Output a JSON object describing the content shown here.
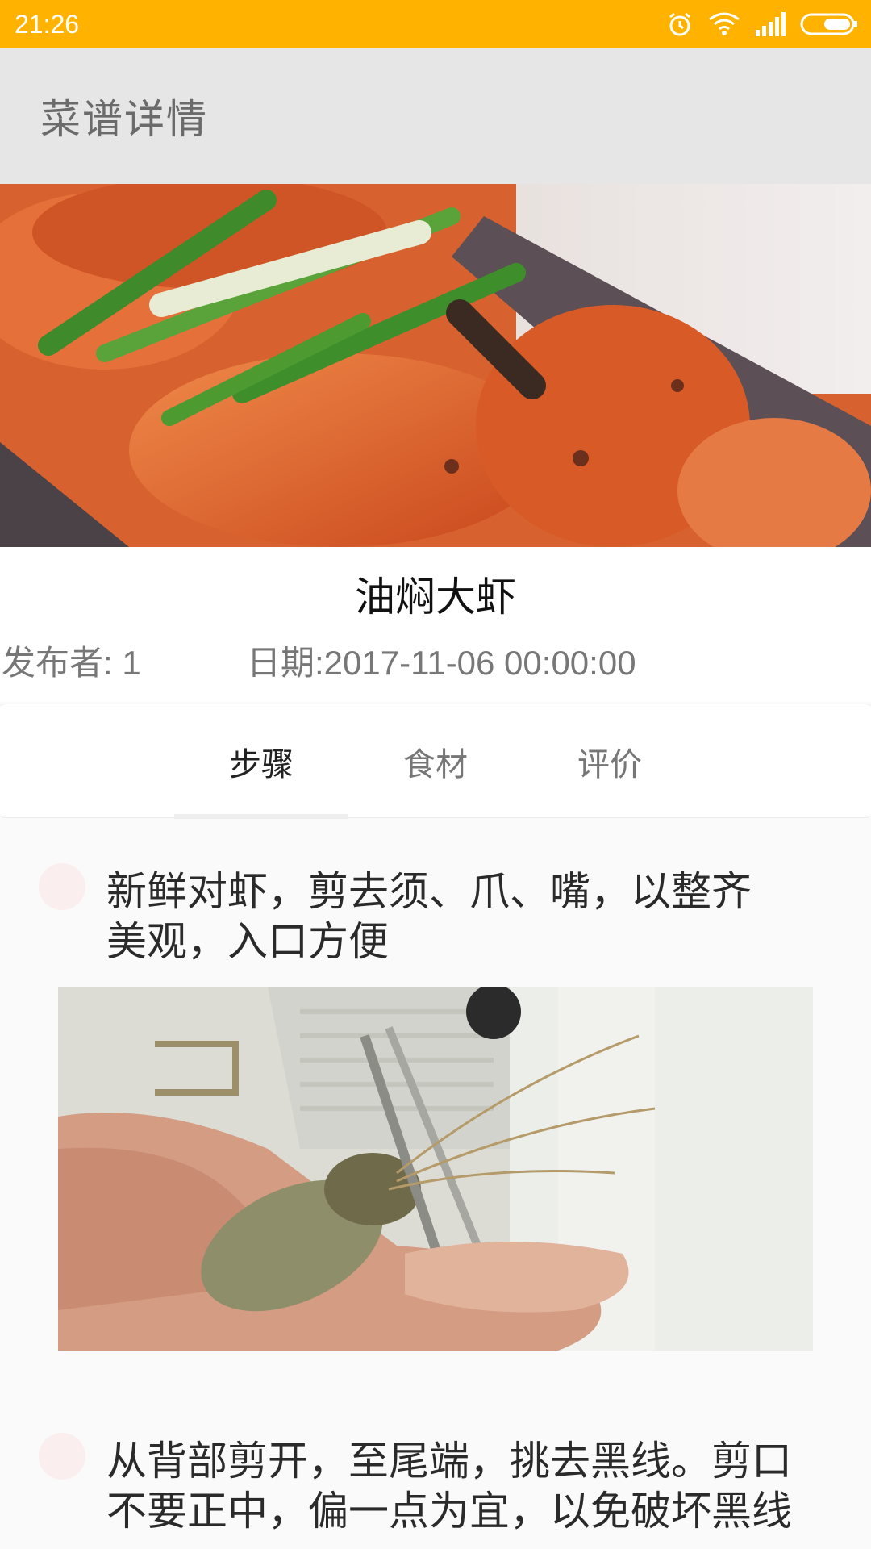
{
  "status_bar": {
    "time": "21:26",
    "icons": [
      "alarm-icon",
      "wifi-icon",
      "signal-icon",
      "battery-icon"
    ]
  },
  "toolbar": {
    "title": "菜谱详情"
  },
  "recipe": {
    "name": "油焖大虾",
    "publisher": "发布者: 1",
    "date": "日期:2017-11-06 00:00:00"
  },
  "tabs": [
    {
      "label": "步骤",
      "active": true
    },
    {
      "label": "食材",
      "active": false
    },
    {
      "label": "评价",
      "active": false
    }
  ],
  "steps": [
    {
      "text_line1": "新鲜对虾，剪去须、爪、嘴，以整齐",
      "text_line2": "美观，入口方便"
    },
    {
      "text_line1": "从背部剪开，至尾端，挑去黑线。剪口",
      "text_line2": "不要正中，偏一点为宜，以免破坏黑线"
    }
  ],
  "colors": {
    "status_bar": "#ffb300",
    "toolbar": "#e6e6e6",
    "background": "#fafafa"
  }
}
